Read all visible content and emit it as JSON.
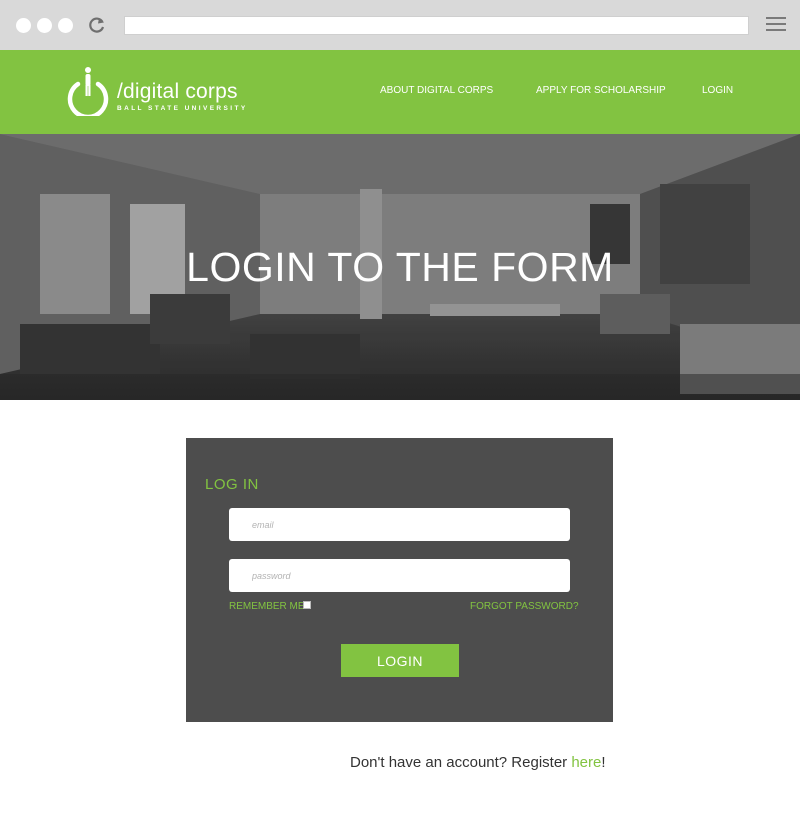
{
  "browser": {
    "icons": [
      "window-dot",
      "reload-icon",
      "hamburger-menu-icon"
    ]
  },
  "header": {
    "logo_title": "/digital corps",
    "logo_subtitle": "BALL STATE UNIVERSITY",
    "logo_icon": "power-person-icon",
    "nav": [
      {
        "label": "ABOUT DIGITAL CORPS"
      },
      {
        "label": "APPLY FOR SCHOLARSHIP"
      },
      {
        "label": "LOGIN"
      }
    ],
    "color": "#82c341"
  },
  "hero": {
    "title": "LOGIN TO THE FORM"
  },
  "login_form": {
    "heading": "LOG IN",
    "email_placeholder": "email",
    "password_placeholder": "password",
    "remember_label": "REMEMBER ME",
    "remember_checked": false,
    "forgot_label": "FORGOT PASSWORD?",
    "submit_label": "LOGIN",
    "panel_color": "#4d4d4d"
  },
  "footer": {
    "register_prefix": "Don't have an account? Register ",
    "register_link": "here",
    "register_suffix": "!"
  }
}
